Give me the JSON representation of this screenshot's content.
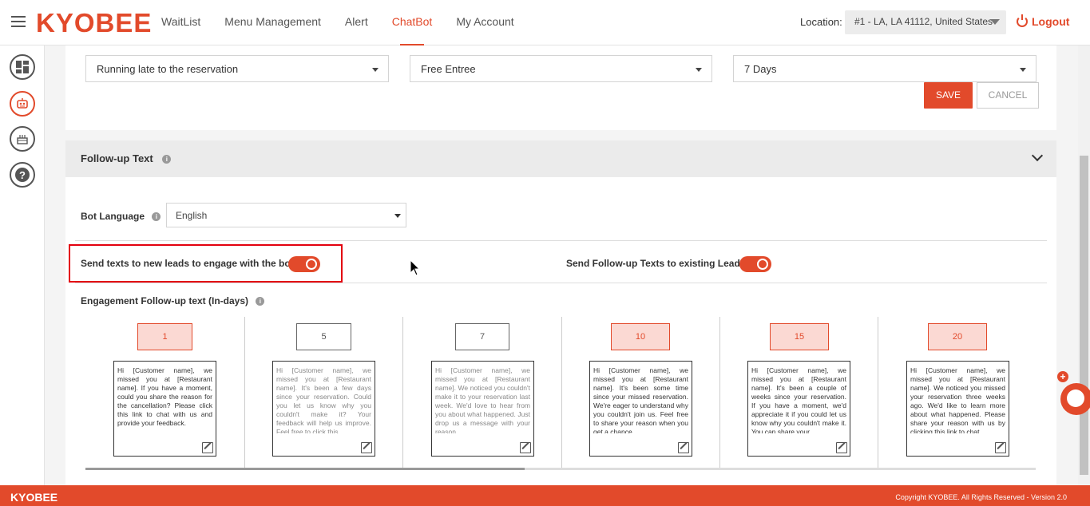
{
  "header": {
    "logo": "KYOBEE",
    "nav": [
      "WaitList",
      "Menu Management",
      "Alert",
      "ChatBot",
      "My Account"
    ],
    "active_nav": "ChatBot",
    "location_label": "Location:",
    "location_value": "#1 - LA, LA 41112, United States",
    "logout": "Logout"
  },
  "sidebar": {
    "icons": [
      "dashboard-icon",
      "robot-icon",
      "cake-icon",
      "help-icon"
    ]
  },
  "top_card": {
    "select_1": "Running late to the reservation",
    "select_2": "Free Entree",
    "select_3": "7 Days",
    "save": "SAVE",
    "cancel": "CANCEL"
  },
  "followup": {
    "title": "Follow-up Text",
    "bot_language_label": "Bot Language",
    "bot_language": "English",
    "new_leads_label": "Send texts to new leads to engage with the bot",
    "new_leads_on": true,
    "existing_leads_label": "Send Follow-up Texts to existing Leads",
    "existing_leads_on": true,
    "engagement_label": "Engagement Follow-up text (In-days)",
    "columns": [
      {
        "day": "1",
        "highlight": true,
        "text": "Hi [Customer name], we missed you at [Restaurant name]. If you have a moment, could you share the reason for the cancellation? Please click this link to chat with us and provide your feedback."
      },
      {
        "day": "5",
        "highlight": false,
        "text": "Hi [Customer name], we missed you at [Restaurant name]. It's been a few days since your reservation. Could you let us know why you couldn't make it? Your feedback will help us improve. Feel free to click this"
      },
      {
        "day": "7",
        "highlight": false,
        "text": "Hi [Customer name], we missed you at [Restaurant name]. We noticed you couldn't make it to your reservation last week. We'd love to hear from you about what happened. Just drop us a message with your reason"
      },
      {
        "day": "10",
        "highlight": true,
        "text": "Hi [Customer name], we missed you at [Restaurant name]. It's been some time since your missed reservation. We're eager to understand why you couldn't join us. Feel free to share your reason when you get a chance"
      },
      {
        "day": "15",
        "highlight": true,
        "text": "Hi [Customer name], we missed you at [Restaurant name]. It's been a couple of weeks since your reservation. If you have a moment, we'd appreciate it if you could let us know why you couldn't make it. You can share your"
      },
      {
        "day": "20",
        "highlight": true,
        "text": "Hi [Customer name], we missed you at [Restaurant name]. We noticed you missed your reservation three weeks ago. We'd like to learn more about what happened. Please share your reason with us by clicking this link to chat"
      }
    ]
  },
  "footer": {
    "logo": "KYOBEE",
    "copyright": "Copyright KYOBEE. All Rights Reserved - Version 2.0"
  },
  "colors": {
    "accent": "#e24a2b",
    "highlight_box": "#e3000f"
  }
}
